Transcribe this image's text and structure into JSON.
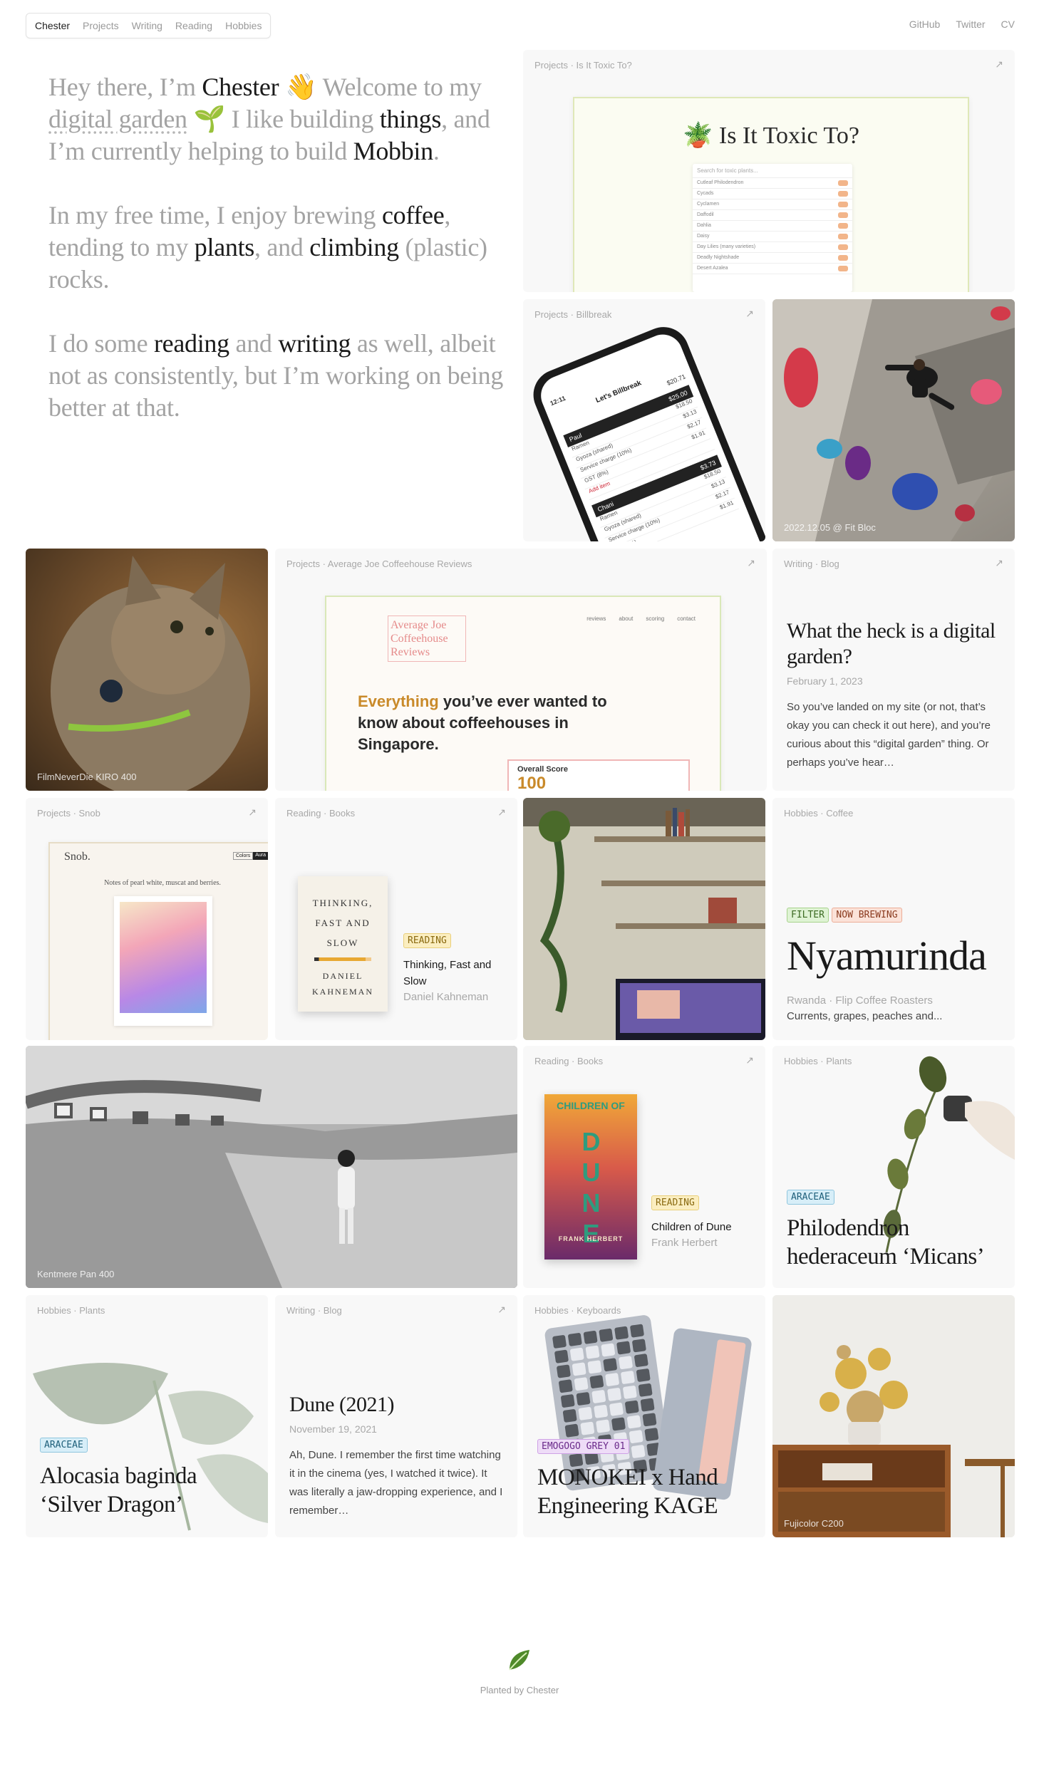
{
  "nav": {
    "left": [
      "Chester",
      "Projects",
      "Writing",
      "Reading",
      "Hobbies"
    ],
    "right": [
      "GitHub",
      "Twitter",
      "CV"
    ]
  },
  "intro": {
    "p1": {
      "a": "Hey there, I’m ",
      "name": "Chester",
      "wave": "👋",
      "b": " Welcome to my ",
      "garden": "digital garden",
      "sprout": "🌱",
      "c": " I like building ",
      "things": "things",
      "d": ", and I’m currently helping to build ",
      "mobbin": "Mobbin",
      "e": "."
    },
    "p2": {
      "a": "In my free time, I enjoy brewing ",
      "coffee": "coffee",
      "b": ", tending to my ",
      "plants": "plants",
      "c": ", and ",
      "climbing": "climbing",
      "d": " (plastic) rocks."
    },
    "p3": {
      "a": "I do some ",
      "reading": "reading",
      "b": " and ",
      "writing": "writing",
      "c": " as well, albeit not as consistently, but I’m working on being better at that."
    }
  },
  "cards": {
    "toxic": {
      "label": "Projects · Is It Toxic To?",
      "arrow": "↗",
      "title": "Is It Toxic To?",
      "search_placeholder": "Search for toxic plants...",
      "rows": [
        "Cutleaf Philodendron",
        "Cycads",
        "Cyclamen",
        "Daffodil",
        "Dahlia",
        "Daisy",
        "Day Lilies (many varieties)",
        "Deadly Nightshade",
        "Desert Azalea"
      ]
    },
    "billbreak": {
      "label": "Projects · Billbreak",
      "arrow": "↗",
      "screen_title": "Let's Billbreak",
      "time": "12:11",
      "total": "$20.71",
      "person1": "Paul",
      "p1_total": "$25.00",
      "person2": "Chani",
      "p2_total": "$3.73",
      "items": [
        {
          "name": "Ramen",
          "price": "$18.50"
        },
        {
          "name": "Gyoza (shared)",
          "price": "$3.13"
        },
        {
          "name": "Service charge (10%)",
          "price": "$2.17"
        },
        {
          "name": "GST (8%)",
          "price": "$1.91"
        }
      ],
      "add": "Add item"
    },
    "climb": {
      "caption": "2022.12.05 @ Fit Bloc"
    },
    "cat": {
      "caption": "FilmNeverDie KIRO 400"
    },
    "coffeehouse": {
      "label": "Projects · Average Joe Coffeehouse Reviews",
      "arrow": "↗",
      "logo": "Average Joe Coffeehouse Reviews",
      "nav": [
        "reviews",
        "about",
        "scoring",
        "contact"
      ],
      "headline_a": "Everything",
      "headline_b": " you’ve ever wanted to know about coffeehouses in Singapore.",
      "score_label": "Overall Score",
      "score": "100"
    },
    "blog1": {
      "label": "Writing · Blog",
      "arrow": "↗",
      "title": "What the heck is a digital garden?",
      "date": "February 1, 2023",
      "body": "So you’ve landed on my site (or not, that’s okay you can check it out here), and you’re curious about this “digital garden” thing. Or perhaps you’ve hear…"
    },
    "snob": {
      "label": "Projects · Snob",
      "arrow": "↗",
      "logo": "Snob.",
      "tagline": "Notes of pearl white, muscat and berries.",
      "toggle_a": "Colors",
      "toggle_b": "Aura"
    },
    "book1": {
      "label": "Reading · Books",
      "arrow": "↗",
      "tag": "READING",
      "title": "Thinking, Fast and Slow",
      "author": "Daniel Kahneman",
      "cover_title": "THINKING, FAST AND SLOW",
      "cover_author": "DANIEL KAHNEMAN"
    },
    "coffee": {
      "label": "Hobbies · Coffee",
      "tag1": "FILTER",
      "tag2": "NOW BREWING",
      "name": "Nyamurinda",
      "origin": "Rwanda · Flip Coffee Roasters",
      "notes": "Currents, grapes, peaches and..."
    },
    "beach": {
      "caption": "Kentmere Pan 400"
    },
    "book2": {
      "label": "Reading · Books",
      "arrow": "↗",
      "tag": "READING",
      "title": "Children of Dune",
      "author": "Frank Herbert",
      "cover_top": "CHILDREN OF",
      "cover_main": "DUNE",
      "cover_author": "FRANK HERBERT"
    },
    "plant1": {
      "label": "Hobbies · Plants",
      "tag": "ARACEAE",
      "name": "Philodendron hederaceum ‘Micans’"
    },
    "plant2": {
      "label": "Hobbies · Plants",
      "tag": "ARACEAE",
      "name": "Alocasia baginda ‘Silver Dragon’"
    },
    "blog2": {
      "label": "Writing · Blog",
      "arrow": "↗",
      "title": "Dune (2021)",
      "date": "November 19, 2021",
      "body": "Ah, Dune. I remember the first time watching it in the cinema (yes, I watched it twice). It was literally a jaw-dropping experience, and I remember…"
    },
    "keyboard": {
      "label": "Hobbies · Keyboards",
      "tag": "EMOGOGO GREY 01",
      "name": "MONOKEI x Hand Engineering KAGE"
    },
    "shelf": {
      "caption": "Fujicolor C200"
    }
  },
  "footer": {
    "text": "Planted by Chester"
  }
}
